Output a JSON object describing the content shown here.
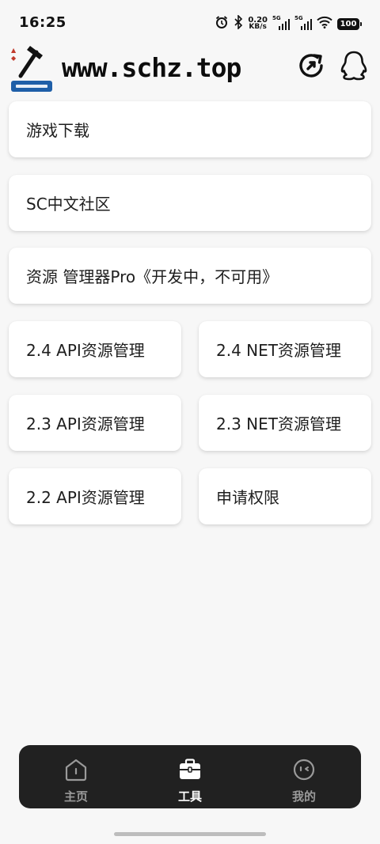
{
  "status_bar": {
    "time": "16:25",
    "net_speed_value": "0.20",
    "net_speed_unit": "KB/s",
    "sim1": "5G",
    "sim2": "5G",
    "battery": "100"
  },
  "header": {
    "logo_icon": "hammer-logo-icon",
    "title": "www.schz.top",
    "refresh_icon": "refresh-icon",
    "qq_icon": "qq-icon"
  },
  "cards": {
    "game_download": "游戏下载",
    "sc_community": "SC中文社区",
    "resource_manager_pro": "资源 管理器Pro《开发中，不可用》",
    "api_24": "2.4 API资源管理",
    "net_24": "2.4 NET资源管理",
    "api_23": "2.3 API资源管理",
    "net_23": "2.3 NET资源管理",
    "api_22": "2.2 API资源管理",
    "request_permission": "申请权限"
  },
  "bottom_nav": {
    "home": "主页",
    "tools": "工具",
    "mine": "我的",
    "active": "tools"
  },
  "colors": {
    "background": "#f7f7f7",
    "card": "#ffffff",
    "nav_bg": "#212121",
    "nav_active": "#ffffff",
    "nav_inactive": "#9a9a9a"
  }
}
